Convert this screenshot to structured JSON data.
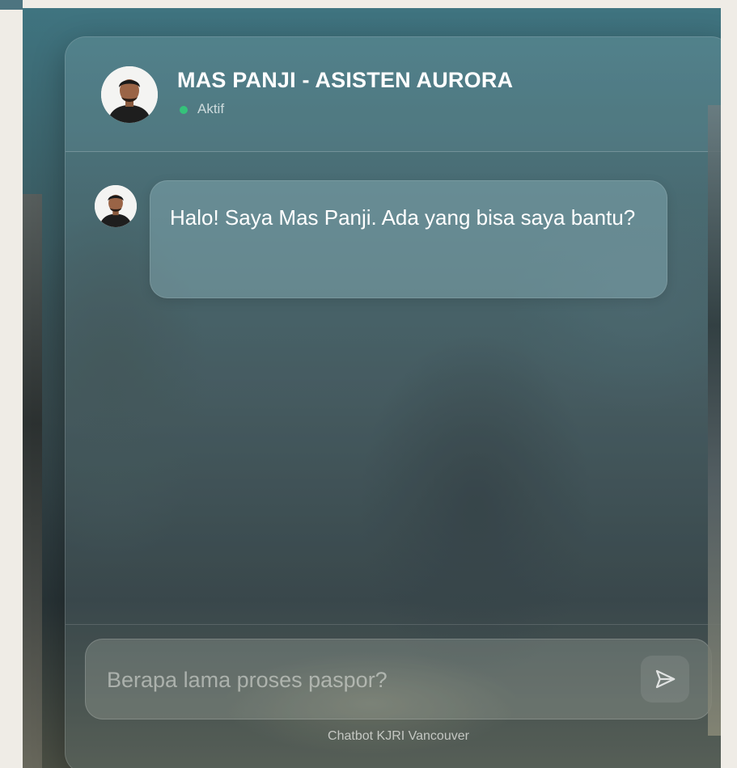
{
  "header": {
    "assistant_name": "MAS PANJI - ASISTEN AURORA",
    "status": "Aktif",
    "avatar_icon": "person-avatar-icon",
    "status_color": "#35c27a"
  },
  "messages": [
    {
      "sender": "bot",
      "avatar_icon": "person-avatar-icon",
      "text": "Halo! Saya Mas Panji. Ada yang bisa saya bantu?"
    }
  ],
  "composer": {
    "placeholder": "Berapa lama proses paspor?",
    "value": "",
    "send_icon": "send-icon"
  },
  "footer": {
    "text": "Chatbot KJRI Vancouver"
  }
}
